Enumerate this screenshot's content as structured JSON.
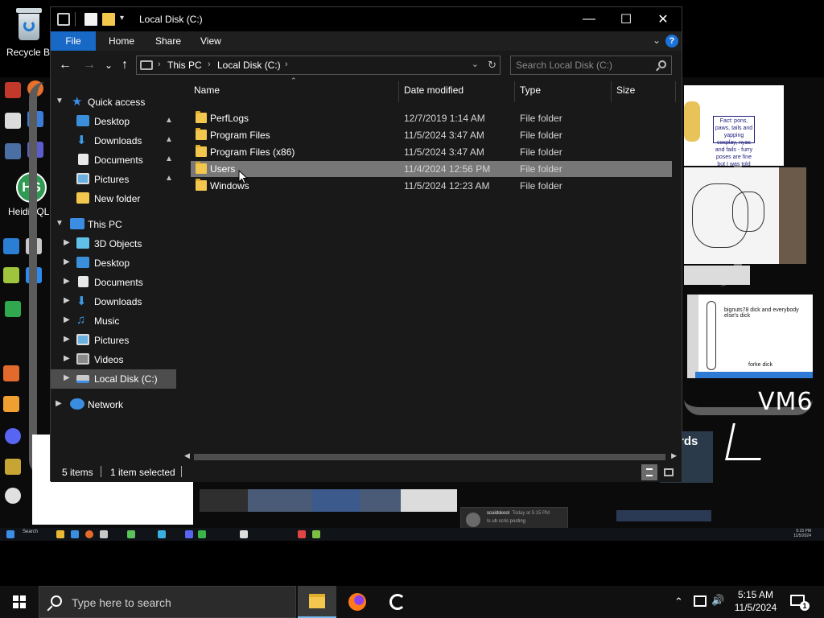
{
  "desktop": {
    "recycle_bin_label": "Recycle Bin",
    "heidisql_label": "HeidiSQL",
    "heidisql_badge": "HS",
    "scribble_text": "VM6",
    "thumb_note": "Fact: pons, paws, tails and yapping cosplay, nyas and fails - furry poses are fine but I was told and then nothing, I'm annoyed",
    "thumb_caption": "bignuts78 dick and everybody else's dick",
    "thumb_caption2": "forke dick",
    "card_text": "rds",
    "inner_notification": {
      "name": "scuidskool",
      "time": "Today at 5:15 PM",
      "message": "Is ub scris posting"
    },
    "inner_taskbar": {
      "search": "Search",
      "clock": "5:15 PM\n11/5/2024"
    }
  },
  "explorer": {
    "title": "Local Disk (C:)",
    "window_controls": {
      "minimize": "—",
      "maximize": "☐",
      "close": "✕"
    },
    "ribbon_tabs": {
      "file": "File",
      "home": "Home",
      "share": "Share",
      "view": "View"
    },
    "ribbon_expand": "⌄",
    "help": "?",
    "nav": {
      "back": "←",
      "forward": "→",
      "recent": "⌄",
      "up": "↑"
    },
    "breadcrumb": {
      "this_pc": "This PC",
      "drive": "Local Disk (C:)",
      "sep": "›"
    },
    "addr_dropdown": "⌄",
    "addr_refresh": "↻",
    "search_placeholder": "Search Local Disk (C:)",
    "sidebar": {
      "quick_access": "Quick access",
      "desktop": "Desktop",
      "downloads": "Downloads",
      "documents": "Documents",
      "pictures": "Pictures",
      "new_folder": "New folder",
      "this_pc": "This PC",
      "objects3d": "3D Objects",
      "pc_desktop": "Desktop",
      "pc_documents": "Documents",
      "pc_downloads": "Downloads",
      "music": "Music",
      "pc_pictures": "Pictures",
      "videos": "Videos",
      "local_disk": "Local Disk (C:)",
      "network": "Network"
    },
    "columns": {
      "name": "Name",
      "date": "Date modified",
      "type": "Type",
      "size": "Size"
    },
    "files": [
      {
        "name": "PerfLogs",
        "date": "12/7/2019 1:14 AM",
        "type": "File folder"
      },
      {
        "name": "Program Files",
        "date": "11/5/2024 3:47 AM",
        "type": "File folder"
      },
      {
        "name": "Program Files (x86)",
        "date": "11/5/2024 3:47 AM",
        "type": "File folder"
      },
      {
        "name": "Users",
        "date": "11/4/2024 12:56 PM",
        "type": "File folder"
      },
      {
        "name": "Windows",
        "date": "11/5/2024 12:23 AM",
        "type": "File folder"
      }
    ],
    "status": {
      "items": "5 items",
      "selected": "1 item selected"
    }
  },
  "taskbar": {
    "search_placeholder": "Type here to search",
    "time": "5:15 AM",
    "date": "11/5/2024",
    "notification_count": "1",
    "tray_chevron": "⌃"
  }
}
